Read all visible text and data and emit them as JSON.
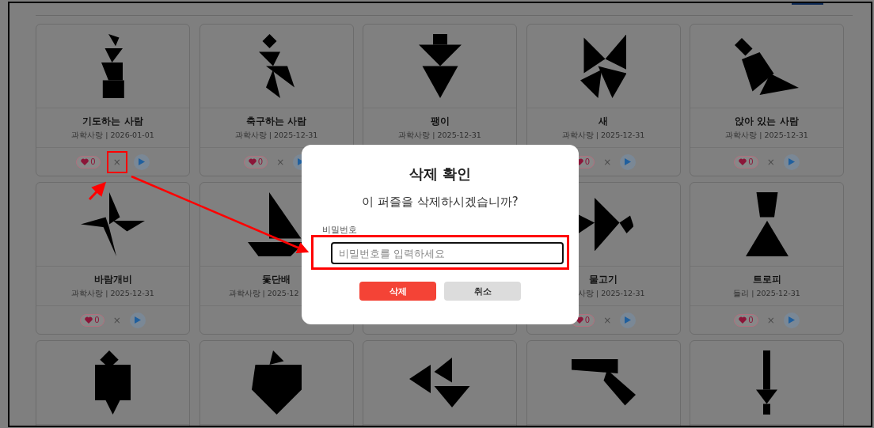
{
  "cards": [
    {
      "kind": "detail",
      "title": "기도하는 사람",
      "meta": "과학사랑 | 2026-01-01",
      "likes": "0",
      "delete": "×",
      "highlighted": true
    },
    {
      "kind": "detail",
      "title": "축구하는 사람",
      "meta": "과학사랑 | 2025-12-31",
      "likes": "0",
      "delete": "×",
      "highlighted": false
    },
    {
      "kind": "detail",
      "title": "팽이",
      "meta": "과학사랑 | 2025-12-31"
    },
    {
      "kind": "detail",
      "title": "새",
      "meta": "과학사랑 | 2025-12-31",
      "likes": "0",
      "delete": "×",
      "highlighted": false
    },
    {
      "kind": "detail",
      "title": "앉아 있는 사람",
      "meta": "과학사랑 | 2025-12-31",
      "likes": "0",
      "delete": "×",
      "highlighted": false
    },
    {
      "kind": "detail",
      "title": "바람개비",
      "meta": "과학사랑 | 2025-12-31",
      "likes": "0",
      "delete": "×",
      "highlighted": false
    },
    {
      "kind": "headcut",
      "title": "돛단배",
      "meta": "과학사랑 | 2025-12"
    },
    {
      "kind": "covered"
    },
    {
      "kind": "tailcut",
      "title": "물고기",
      "meta": "사랑 | 2025-12-31",
      "likes": "0",
      "delete": "×",
      "highlighted": false
    },
    {
      "kind": "detail",
      "title": "트로피",
      "meta": "들리 | 2025-12-31",
      "likes": "0",
      "delete": "×",
      "highlighted": false
    },
    {
      "kind": "image"
    },
    {
      "kind": "image"
    },
    {
      "kind": "image"
    },
    {
      "kind": "image"
    },
    {
      "kind": "image"
    }
  ],
  "dialog": {
    "title": "삭제 확인",
    "message": "이 퍼즐을 삭제하시겠습니까?",
    "field_label": "비밀번호",
    "placeholder": "비밀번호를 입력하세요",
    "field_highlighted": true,
    "confirm": "삭제",
    "cancel": "취소"
  }
}
